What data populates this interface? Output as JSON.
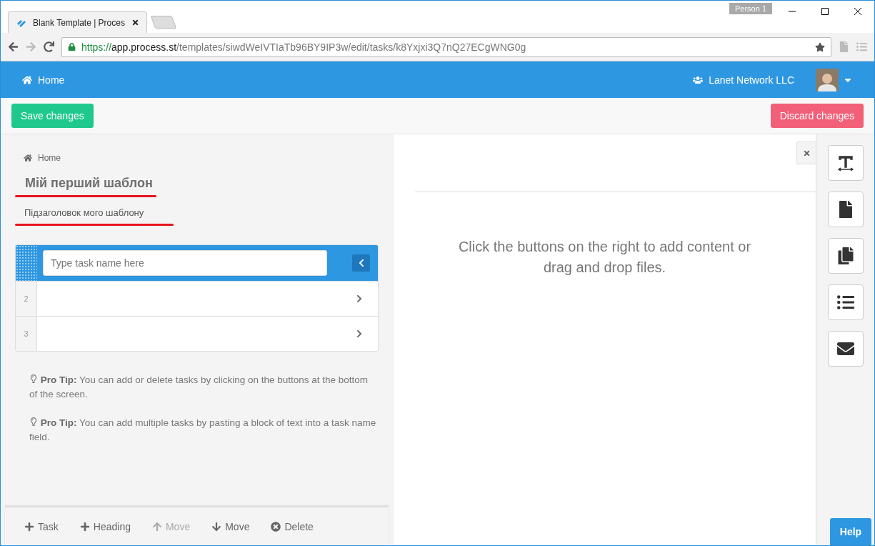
{
  "browser": {
    "tab_title": "Blank Template | Proces",
    "profile": "Person 1",
    "url": {
      "scheme": "https://",
      "host": "app.process.st",
      "path": "/templates/siwdWeIVTIaTb96BY9IP3w/edit/tasks/k8Yxjxi3Q7nQ27ECgWNG0g"
    }
  },
  "header": {
    "home": "Home",
    "organization": "Lanet Network LLC"
  },
  "actions": {
    "save": "Save changes",
    "discard": "Discard changes"
  },
  "breadcrumb": "Home",
  "template": {
    "title": "Мій перший шаблон",
    "subtitle": "Підзаголовок мого шаблону"
  },
  "tasks": [
    {
      "kind": "editing",
      "placeholder": "Type task name here",
      "selected": true
    },
    {
      "kind": "row",
      "number": "2",
      "selected": false
    },
    {
      "kind": "row",
      "number": "3",
      "selected": false
    }
  ],
  "tips": [
    {
      "label": "Pro Tip:",
      "text": "You can add or delete tasks by clicking on the buttons at the bottom of the screen."
    },
    {
      "label": "Pro Tip:",
      "text": "You can add multiple tasks by pasting a block of text into a task name field."
    }
  ],
  "bottom_toolbar": [
    {
      "kind": "add",
      "label": "Task",
      "disabled": false
    },
    {
      "kind": "add",
      "label": "Heading",
      "disabled": false
    },
    {
      "kind": "up",
      "label": "Move",
      "disabled": true
    },
    {
      "kind": "down",
      "label": "Move",
      "disabled": false
    },
    {
      "kind": "delete",
      "label": "Delete",
      "disabled": false
    }
  ],
  "content": {
    "empty_message": "Click the buttons on the right to add content or drag and drop files."
  },
  "content_tools": [
    {
      "kind": "text"
    },
    {
      "kind": "file"
    },
    {
      "kind": "files"
    },
    {
      "kind": "list"
    },
    {
      "kind": "email"
    }
  ],
  "help": "Help"
}
